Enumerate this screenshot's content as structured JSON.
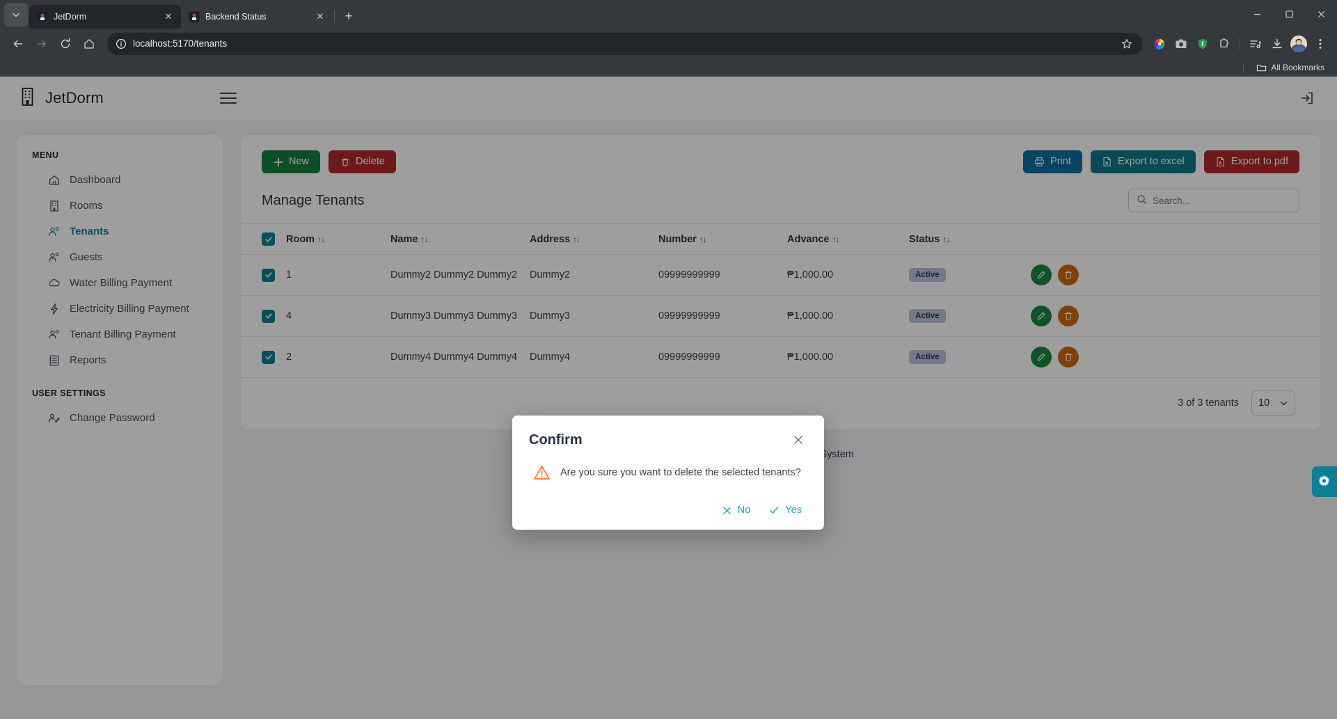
{
  "browser": {
    "tabs": [
      {
        "title": "JetDorm",
        "active": true,
        "favicon": "jetdorm-favicon"
      },
      {
        "title": "Backend Status",
        "active": false,
        "favicon": "backend-favicon"
      }
    ],
    "new_tab_label": "+",
    "url": "localhost:5170/tenants",
    "bookmarks_label": "All Bookmarks",
    "window_controls": {
      "minimize": "—",
      "maximize": "❐",
      "close": "✕"
    }
  },
  "app": {
    "brand": "JetDorm",
    "logo_icon": "building-icon",
    "menu_toggle": "hamburger-icon",
    "logout_icon": "logout-icon"
  },
  "sidebar": {
    "menu_heading": "MENU",
    "items": [
      {
        "label": "Dashboard",
        "icon": "home-icon",
        "active": false
      },
      {
        "label": "Rooms",
        "icon": "building-icon",
        "active": false
      },
      {
        "label": "Tenants",
        "icon": "users-icon",
        "active": true
      },
      {
        "label": "Guests",
        "icon": "users-icon",
        "active": false
      },
      {
        "label": "Water Billing Payment",
        "icon": "cloud-icon",
        "active": false
      },
      {
        "label": "Electricity Billing Payment",
        "icon": "bolt-icon",
        "active": false
      },
      {
        "label": "Tenant Billing Payment",
        "icon": "users-icon",
        "active": false
      },
      {
        "label": "Reports",
        "icon": "report-icon",
        "active": false
      }
    ],
    "settings_heading": "USER SETTINGS",
    "settings_items": [
      {
        "label": "Change Password",
        "icon": "user-edit-icon",
        "active": false
      }
    ]
  },
  "toolbar": {
    "new_label": "New",
    "delete_label": "Delete",
    "print_label": "Print",
    "export_excel_label": "Export to excel",
    "export_pdf_label": "Export to pdf"
  },
  "panel": {
    "title": "Manage Tenants",
    "search_placeholder": "Search...",
    "search_value": ""
  },
  "table": {
    "columns": [
      "Room",
      "Name",
      "Address",
      "Number",
      "Advance",
      "Status"
    ],
    "sort_glyph": "↑↓",
    "header_checkbox_checked": true,
    "rows": [
      {
        "checked": true,
        "room": "1",
        "name": "Dummy2 Dummy2 Dummy2",
        "address": "Dummy2",
        "number": "09999999999",
        "advance": "₱1,000.00",
        "status": "Active"
      },
      {
        "checked": true,
        "room": "4",
        "name": "Dummy3 Dummy3 Dummy3",
        "address": "Dummy3",
        "number": "09999999999",
        "advance": "₱1,000.00",
        "status": "Active"
      },
      {
        "checked": true,
        "room": "2",
        "name": "Dummy4 Dummy4 Dummy4",
        "address": "Dummy4",
        "number": "09999999999",
        "advance": "₱1,000.00",
        "status": "Active"
      }
    ],
    "row_actions": {
      "edit_icon": "pencil-icon",
      "delete_icon": "trash-icon"
    }
  },
  "pagination": {
    "summary": "3 of 3 tenants",
    "page_size": "10"
  },
  "footer": {
    "icon": "building-icon",
    "text": "JetDorm ©  Dormitory System"
  },
  "settings_tab": {
    "icon": "gear-icon"
  },
  "modal": {
    "title": "Confirm",
    "close_icon": "close-icon",
    "warning_icon": "warning-triangle-icon",
    "message": "Are you sure you want to delete the selected tenants?",
    "no_label": "No",
    "yes_label": "Yes"
  },
  "colors": {
    "accent_teal": "#0f7f95",
    "green": "#15803d",
    "red": "#b02a2a",
    "blue": "#0b6e9d",
    "orange": "#cf6a0c",
    "link": "#1aa3c8"
  }
}
